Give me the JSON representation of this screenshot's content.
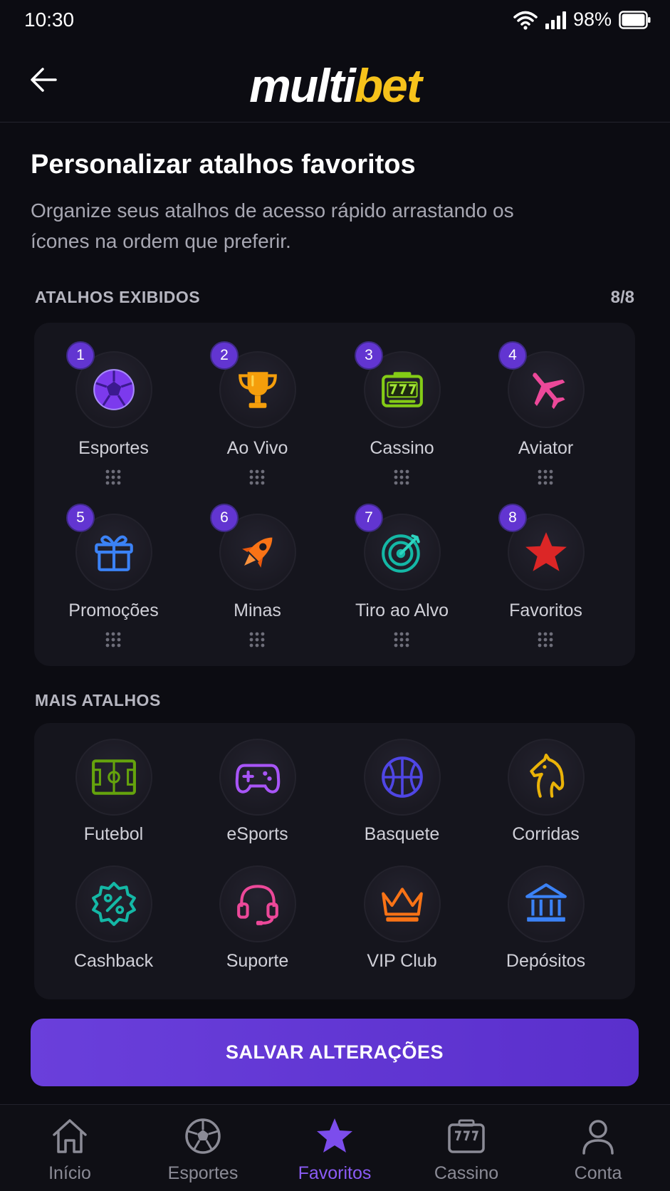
{
  "status": {
    "time": "10:30",
    "battery": "98%"
  },
  "header": {
    "logo_a": "multi",
    "logo_b": "bet"
  },
  "page": {
    "title": "Personalizar atalhos favoritos",
    "subtitle": "Organize seus atalhos de acesso rápido arrastando os ícones na ordem que preferir."
  },
  "shown": {
    "label": "ATALHOS EXIBIDOS",
    "count": "8/8",
    "items": [
      {
        "n": "1",
        "label": "Esportes",
        "icon": "soccer-ball-icon"
      },
      {
        "n": "2",
        "label": "Ao Vivo",
        "icon": "trophy-icon"
      },
      {
        "n": "3",
        "label": "Cassino",
        "icon": "slot-machine-icon"
      },
      {
        "n": "4",
        "label": "Aviator",
        "icon": "airplane-icon"
      },
      {
        "n": "5",
        "label": "Promoções",
        "icon": "gift-icon"
      },
      {
        "n": "6",
        "label": "Minas",
        "icon": "rocket-icon"
      },
      {
        "n": "7",
        "label": "Tiro ao Alvo",
        "icon": "target-icon"
      },
      {
        "n": "8",
        "label": "Favoritos",
        "icon": "star-icon"
      }
    ]
  },
  "more": {
    "label": "MAIS ATALHOS",
    "items": [
      {
        "label": "Futebol",
        "icon": "soccer-field-icon"
      },
      {
        "label": "eSports",
        "icon": "gamepad-icon"
      },
      {
        "label": "Basquete",
        "icon": "basketball-icon"
      },
      {
        "label": "Corridas",
        "icon": "horse-icon"
      },
      {
        "label": "Cashback",
        "icon": "percent-badge-icon"
      },
      {
        "label": "Suporte",
        "icon": "headset-icon"
      },
      {
        "label": "VIP Club",
        "icon": "crown-icon"
      },
      {
        "label": "Depósitos",
        "icon": "bank-icon"
      }
    ]
  },
  "save_label": "SALVAR ALTERAÇÕES",
  "nav": [
    {
      "label": "Início",
      "icon": "home-icon"
    },
    {
      "label": "Esportes",
      "icon": "soccer-ball-icon"
    },
    {
      "label": "Favoritos",
      "icon": "star-icon",
      "active": true
    },
    {
      "label": "Cassino",
      "icon": "slot-machine-icon"
    },
    {
      "label": "Conta",
      "icon": "user-icon"
    }
  ],
  "colors": {
    "accent": "#6a3fdb",
    "brand_yellow": "#f6c21b",
    "background": "#0c0c12",
    "card": "#15151d"
  }
}
